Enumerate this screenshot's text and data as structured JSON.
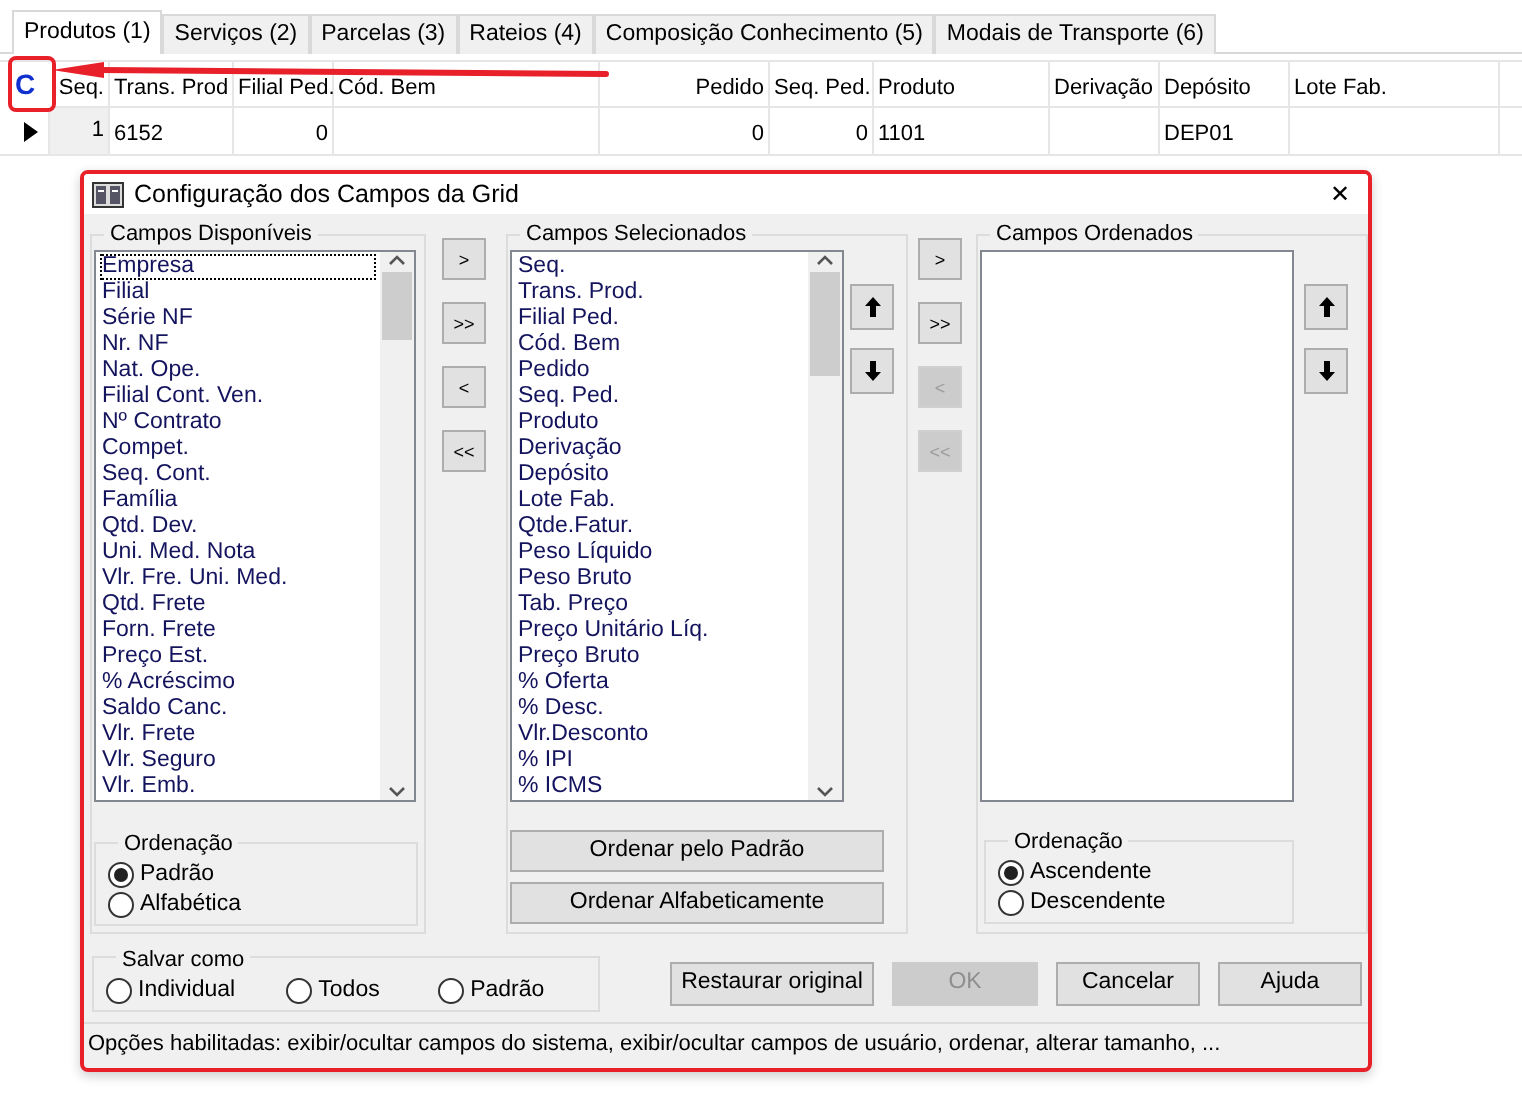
{
  "tabs": [
    {
      "label": "Produtos (1)",
      "selected": true
    },
    {
      "label": "Serviços (2)",
      "selected": false
    },
    {
      "label": "Parcelas (3)",
      "selected": false
    },
    {
      "label": "Rateios (4)",
      "selected": false
    },
    {
      "label": "Composição Conhecimento (5)",
      "selected": false
    },
    {
      "label": "Modais de Transporte (6)",
      "selected": false
    }
  ],
  "grid": {
    "corner_button": "C",
    "columns": [
      "Seq.",
      "Trans. Prod",
      "Filial Ped.",
      "Cód. Bem",
      "Pedido",
      "Seq. Ped.",
      "Produto",
      "Derivação",
      "Depósito",
      "Lote Fab."
    ],
    "rows": [
      {
        "current": true,
        "cells": [
          "1",
          "6152",
          "0",
          null,
          "0",
          "0",
          "1101",
          null,
          "DEP01",
          null
        ]
      }
    ]
  },
  "dialog": {
    "title": "Configuração dos Campos da Grid",
    "close": "✕",
    "available": {
      "title": "Campos Disponíveis",
      "items": [
        {
          "label": "Empresa",
          "focused": true
        },
        {
          "label": "Filial",
          "focused": false
        },
        {
          "label": "Série NF",
          "focused": false
        },
        {
          "label": "Nr. NF",
          "focused": false
        },
        {
          "label": "Nat. Ope.",
          "focused": false
        },
        {
          "label": "Filial Cont. Ven.",
          "focused": false
        },
        {
          "label": "Nº Contrato",
          "focused": false
        },
        {
          "label": "Compet.",
          "focused": false
        },
        {
          "label": "Seq. Cont.",
          "focused": false
        },
        {
          "label": "Família",
          "focused": false
        },
        {
          "label": "Qtd. Dev.",
          "focused": false
        },
        {
          "label": "Uni. Med. Nota",
          "focused": false
        },
        {
          "label": "Vlr. Fre. Uni. Med.",
          "focused": false
        },
        {
          "label": "Qtd. Frete",
          "focused": false
        },
        {
          "label": "Forn. Frete",
          "focused": false
        },
        {
          "label": "Preço Est.",
          "focused": false
        },
        {
          "label": "% Acréscimo",
          "focused": false
        },
        {
          "label": "Saldo Canc.",
          "focused": false
        },
        {
          "label": "Vlr. Frete",
          "focused": false
        },
        {
          "label": "Vlr. Seguro",
          "focused": false
        },
        {
          "label": "Vlr. Emb.",
          "focused": false
        }
      ]
    },
    "available_sort": {
      "title": "Ordenação",
      "options": [
        {
          "label": "Padrão",
          "selected": true
        },
        {
          "label": "Alfabética",
          "selected": false
        }
      ]
    },
    "move_buttons": [
      {
        "label": ">",
        "disabled": false
      },
      {
        "label": ">>",
        "disabled": false
      },
      {
        "label": "<",
        "disabled": false
      },
      {
        "label": "<<",
        "disabled": false
      }
    ],
    "selected": {
      "title": "Campos Selecionados",
      "items": [
        "Seq.",
        "Trans. Prod.",
        "Filial Ped.",
        "Cód. Bem",
        "Pedido",
        "Seq. Ped.",
        "Produto",
        "Derivação",
        "Depósito",
        "Lote Fab.",
        "Qtde.Fatur.",
        "Peso Líquido",
        "Peso Bruto",
        "Tab. Preço",
        "Preço Unitário Líq.",
        "Preço Bruto",
        "% Oferta",
        "% Desc.",
        "Vlr.Desconto",
        "% IPI",
        "% ICMS"
      ]
    },
    "sort_buttons": [
      "Ordenar pelo Padrão",
      "Ordenar Alfabeticamente"
    ],
    "order_move_buttons": [
      {
        "label": ">",
        "disabled": false
      },
      {
        "label": ">>",
        "disabled": false
      },
      {
        "label": "<",
        "disabled": true
      },
      {
        "label": "<<",
        "disabled": true
      }
    ],
    "ordered": {
      "title": "Campos Ordenados"
    },
    "ordered_sort": {
      "title": "Ordenação",
      "options": [
        {
          "label": "Ascendente",
          "selected": true
        },
        {
          "label": "Descendente",
          "selected": false
        }
      ]
    },
    "save_as": {
      "title": "Salvar como",
      "options": [
        {
          "label": "Individual",
          "selected": false
        },
        {
          "label": "Todos",
          "selected": false
        },
        {
          "label": "Padrão",
          "selected": false
        }
      ]
    },
    "buttons": [
      {
        "label": "Restaurar original",
        "disabled": false
      },
      {
        "label": "OK",
        "disabled": true
      },
      {
        "label": "Cancelar",
        "disabled": false
      },
      {
        "label": "Ajuda",
        "disabled": false
      }
    ],
    "status": "Opções habilitadas: exibir/ocultar campos do sistema, exibir/ocultar campos de usuário, ordenar, alterar tamanho, ..."
  }
}
